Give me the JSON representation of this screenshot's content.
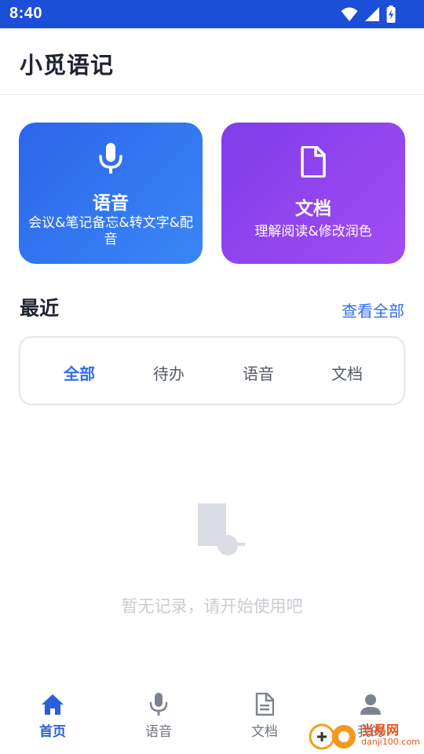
{
  "status_bar": {
    "time": "8:40",
    "icons": [
      "wifi-icon",
      "cellular-signal-icon",
      "battery-charging-icon"
    ]
  },
  "app_bar": {
    "title": "小觅语记"
  },
  "cards": [
    {
      "id": "voice",
      "icon": "microphone-icon",
      "title": "语音",
      "subtitle": "会议&笔记备忘&转文字&配音"
    },
    {
      "id": "doc",
      "icon": "document-icon",
      "title": "文档",
      "subtitle": "理解阅读&修改润色"
    }
  ],
  "recent": {
    "title": "最近",
    "view_all": "查看全部",
    "tabs": [
      {
        "label": "全部",
        "active": true
      },
      {
        "label": "待办",
        "active": false
      },
      {
        "label": "语音",
        "active": false
      },
      {
        "label": "文档",
        "active": false
      }
    ],
    "empty_text": "暂无记录，请开始使用吧"
  },
  "bottom_nav": [
    {
      "label": "首页",
      "icon": "home-icon",
      "active": true
    },
    {
      "label": "语音",
      "icon": "microphone-icon",
      "active": false
    },
    {
      "label": "文档",
      "icon": "document-icon",
      "active": false
    },
    {
      "label": "我的",
      "icon": "person-icon",
      "active": false
    }
  ],
  "watermark": {
    "brand": "当易网",
    "url": "danji100.com"
  },
  "colors": {
    "status_bar": "#1b4fd8",
    "accent": "#2f6ef0",
    "voice_card": "#2b66ea",
    "doc_card": "#8b43ee",
    "empty_text": "#c9ccd2"
  }
}
